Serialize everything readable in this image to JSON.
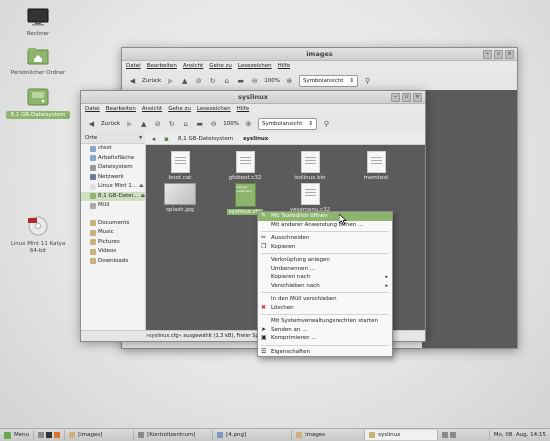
{
  "desktop": {
    "icons": [
      {
        "label": "Rechner",
        "icon": "monitor-icon"
      },
      {
        "label": "Persönlicher Ordner",
        "icon": "home-folder-icon"
      },
      {
        "label": "8,1 GB-Dateisystem",
        "icon": "drive-icon",
        "selected": true
      },
      {
        "label": "Linux Mint 11 Katya 64-bit",
        "icon": "dvd-icon"
      }
    ]
  },
  "back_window": {
    "title": "images",
    "menu": [
      "Datei",
      "Bearbeiten",
      "Ansicht",
      "Gehe zu",
      "Lesezeichen",
      "Hilfe"
    ],
    "back_label": "Zurück",
    "zoom": "100%",
    "view_mode": "Symbolansicht"
  },
  "front_window": {
    "title": "syslinux",
    "menu": [
      "Datei",
      "Bearbeiten",
      "Ansicht",
      "Gehe zu",
      "Lesezeichen",
      "Hilfe"
    ],
    "back_label": "Zurück",
    "zoom": "100%",
    "view_mode": "Symbolansicht",
    "sidebar_header": "Orte",
    "sidebar": [
      {
        "label": "ctest",
        "icon": "home-icon"
      },
      {
        "label": "Arbeitsfläche",
        "icon": "desktop-icon"
      },
      {
        "label": "Dateisystem",
        "icon": "harddisk-icon"
      },
      {
        "label": "Netzwerk",
        "icon": "network-icon"
      },
      {
        "label": "Linux Mint 1...",
        "icon": "disc-icon",
        "eject": true
      },
      {
        "label": "8,1 GB-Datei...",
        "icon": "drive-icon",
        "eject": true,
        "selected": true
      },
      {
        "label": "Müll",
        "icon": "trash-icon"
      }
    ],
    "sidebar2": [
      {
        "label": "Documents",
        "icon": "folder-icon"
      },
      {
        "label": "Music",
        "icon": "folder-icon"
      },
      {
        "label": "Pictures",
        "icon": "folder-icon"
      },
      {
        "label": "Videos",
        "icon": "folder-icon"
      },
      {
        "label": "Downloads",
        "icon": "folder-icon"
      }
    ],
    "breadcrumbs": [
      "8,1 GB-Dateisystem",
      "syslinux"
    ],
    "files": [
      {
        "name": "boot.cat"
      },
      {
        "name": "gfxboot.c32"
      },
      {
        "name": "isolinux.bin"
      },
      {
        "name": "memtest"
      },
      {
        "name": "splash.jpg"
      },
      {
        "name": "syslinux.cfg",
        "selected": true,
        "thumb_text": "default vesamenu"
      },
      {
        "name": "vesamenu.c32"
      }
    ],
    "status": "»syslinux.cfg« ausgewählt (1,3 kB), Freier Speicherplatz: ..."
  },
  "context_menu": {
    "items": [
      {
        "label": "Mit Texteditor öffnen",
        "highlight": true
      },
      {
        "label": "Mit anderer Anwendung öffnen ..."
      },
      {
        "sep": true
      },
      {
        "label": "Ausschneiden",
        "icon": "cut-icon"
      },
      {
        "label": "Kopieren",
        "icon": "copy-icon"
      },
      {
        "sep": true
      },
      {
        "label": "Verknüpfung anlegen"
      },
      {
        "label": "Umbenennen ..."
      },
      {
        "label": "Kopieren nach",
        "submenu": true
      },
      {
        "label": "Verschieben nach",
        "submenu": true
      },
      {
        "sep": true
      },
      {
        "label": "In den Müll verschieben"
      },
      {
        "label": "Löschen",
        "icon": "delete-icon"
      },
      {
        "sep": true
      },
      {
        "label": "Mit Systemverwaltungsrechten starten"
      },
      {
        "label": "Senden an ...",
        "icon": "send-icon"
      },
      {
        "label": "Komprimieren ...",
        "icon": "archive-icon"
      },
      {
        "sep": true
      },
      {
        "label": "Eigenschaften",
        "icon": "properties-icon"
      }
    ]
  },
  "taskbar": {
    "menu_label": "Menu",
    "tasks": [
      {
        "label": "[images]"
      },
      {
        "label": "[Kontrollzentrum]"
      },
      {
        "label": "[4.png]"
      },
      {
        "label": "images"
      },
      {
        "label": "syslinux",
        "active": true
      }
    ],
    "clock": "Mo, 08. Aug, 14:15"
  }
}
